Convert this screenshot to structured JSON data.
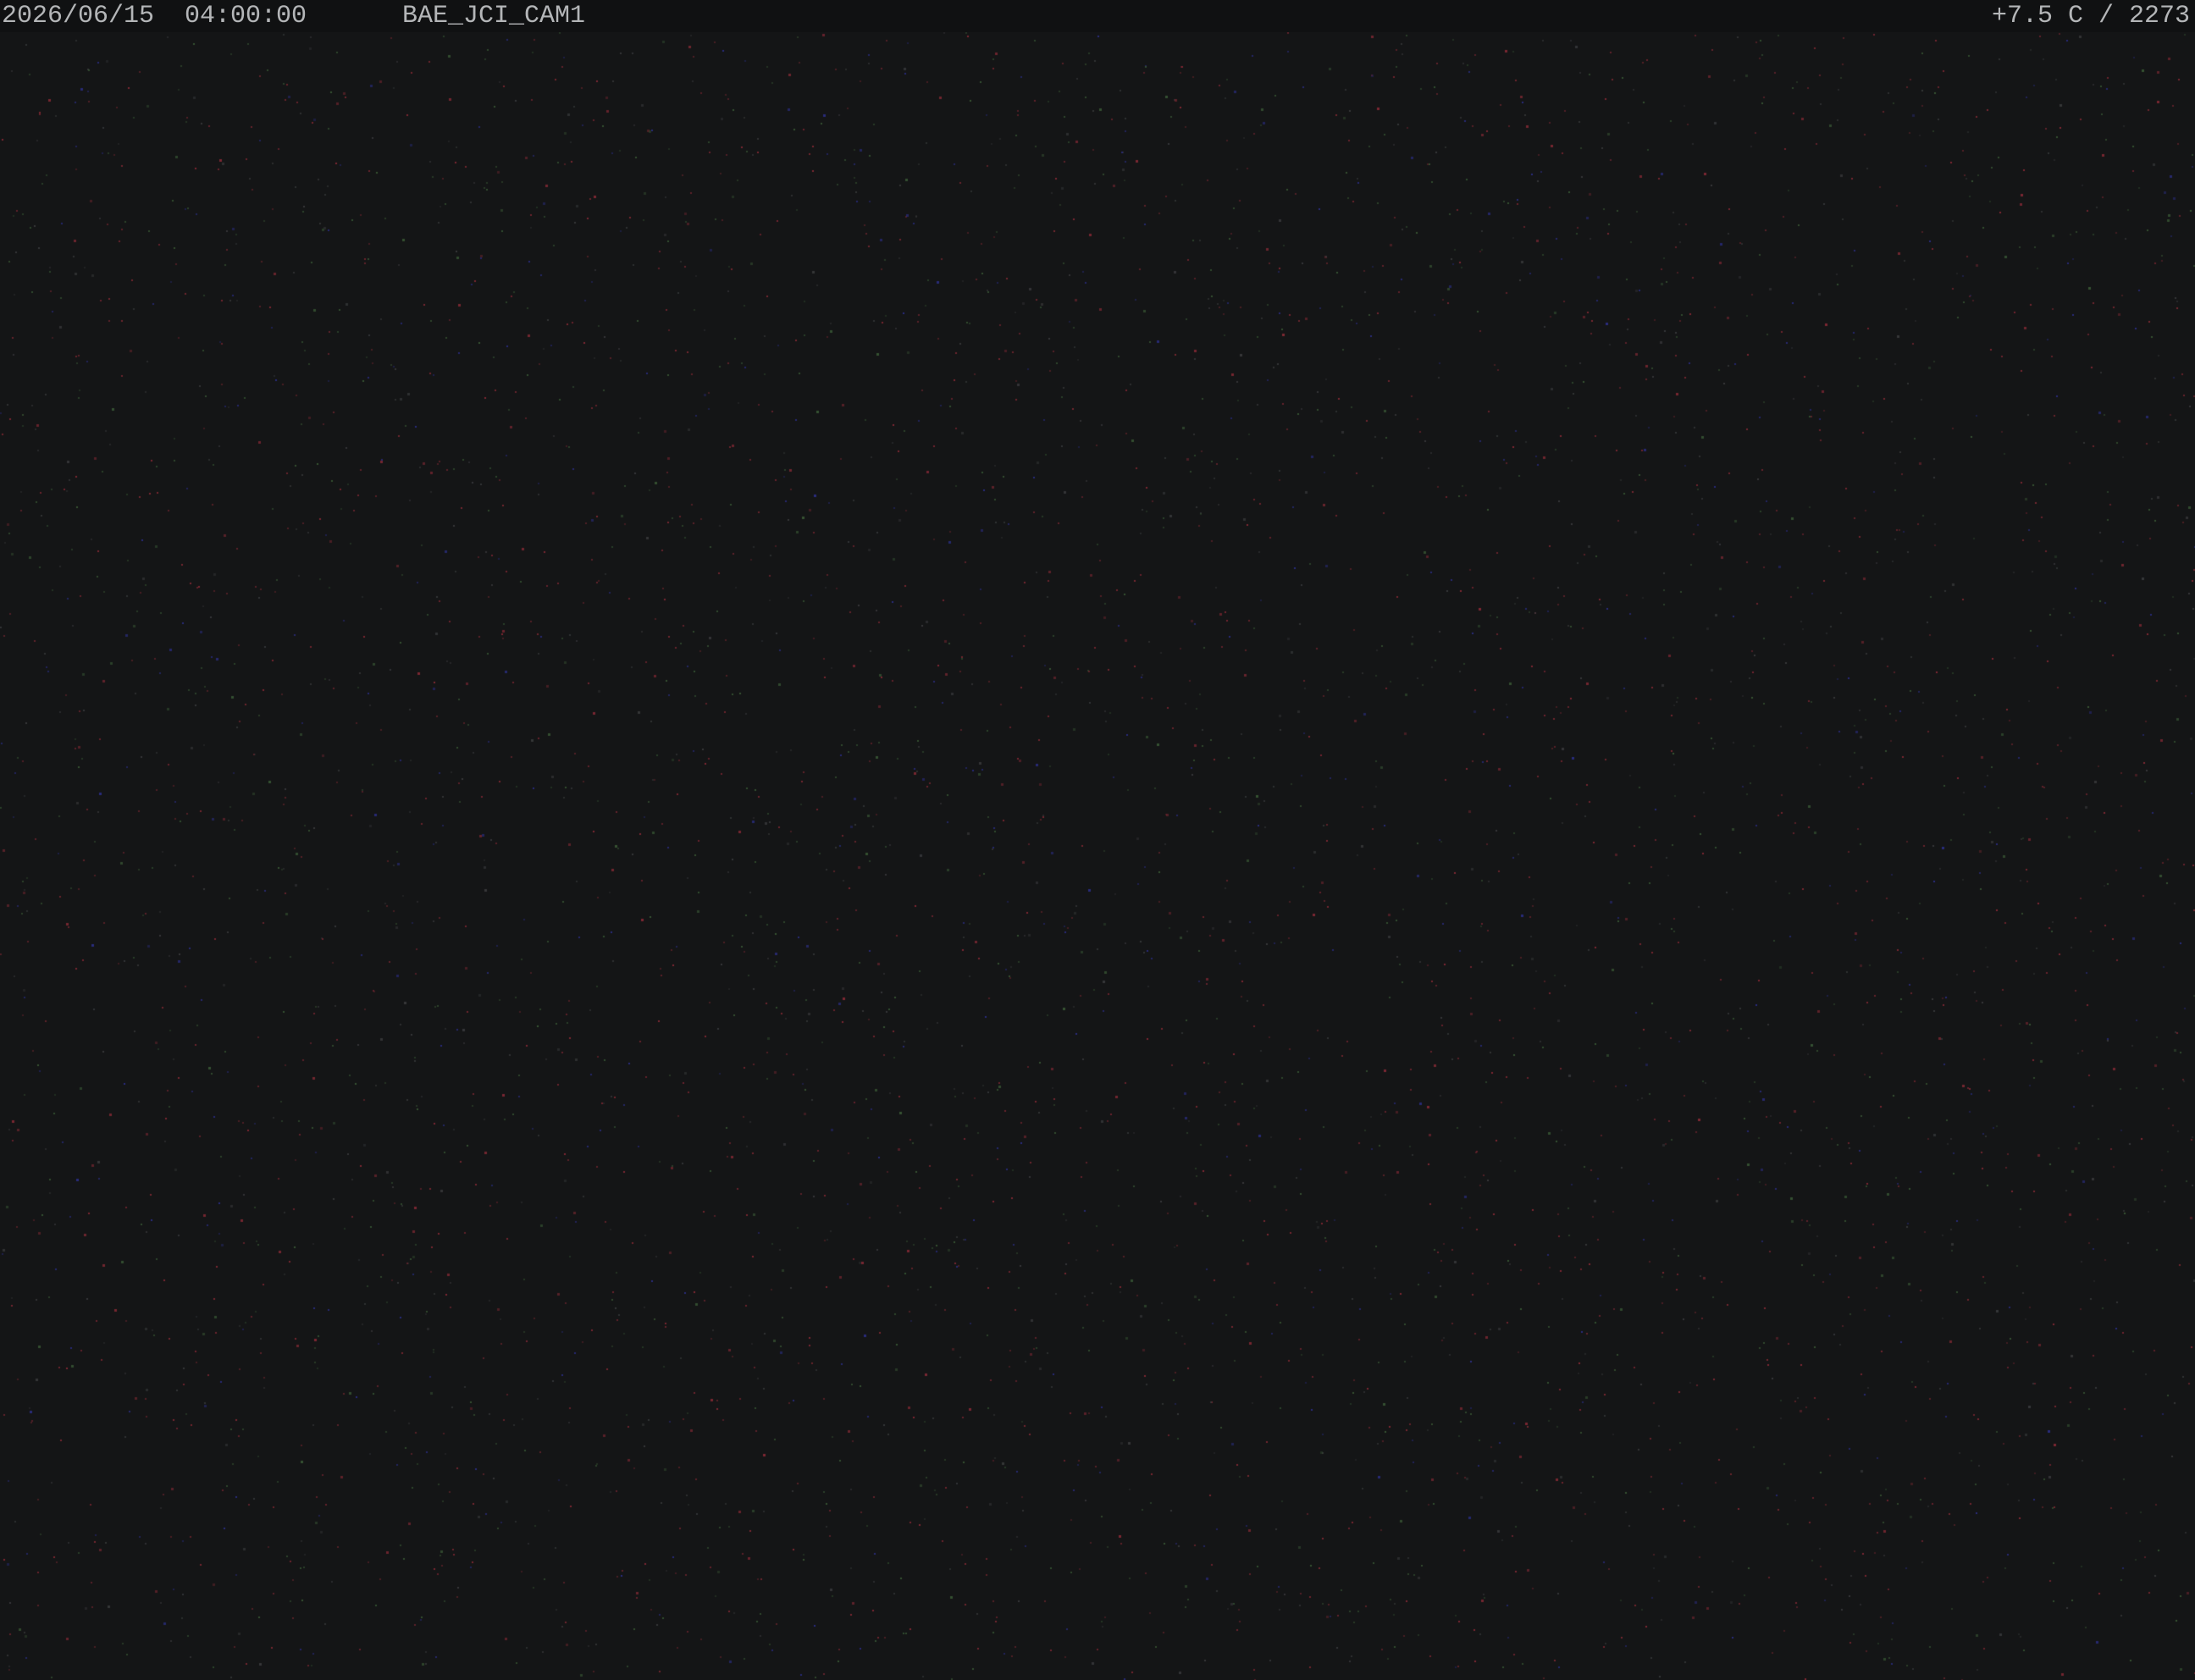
{
  "overlay": {
    "datetime": "2026/06/15  04:00:00",
    "camera_id": "BAE_JCI_CAM1",
    "sensor_readout": "+7.5 C / 2273"
  },
  "colors": {
    "background": "#141516",
    "overlay_bar": "#101112",
    "overlay_text": "#b4b6b8",
    "noise_red": "#8a2a36",
    "noise_blue": "#2c2f8a",
    "noise_green": "#3a5a36",
    "noise_gray": "#3a3b3d"
  }
}
